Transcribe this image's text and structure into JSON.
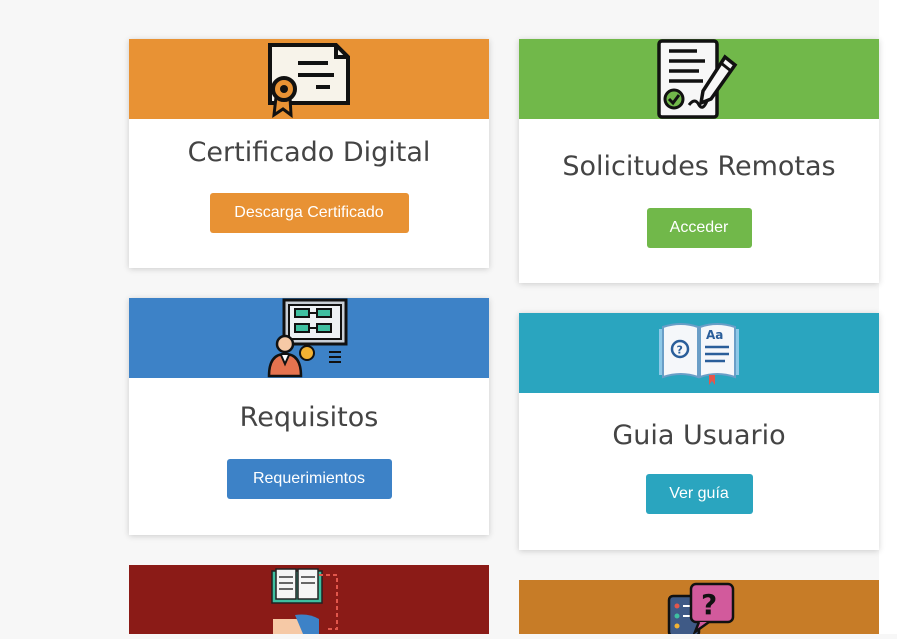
{
  "cards": [
    {
      "title": "Certificado Digital",
      "button": "Descarga Certificado",
      "color": "#e89234",
      "icon": "certificate-icon"
    },
    {
      "title": "Solicitudes Remotas",
      "button": "Acceder",
      "color": "#71b84a",
      "icon": "signed-document-icon"
    },
    {
      "title": "Requisitos",
      "button": "Requerimientos",
      "color": "#3d82c7",
      "icon": "presentation-icon"
    },
    {
      "title": "Guia Usuario",
      "button": "Ver guía",
      "color": "#2aa5bf",
      "icon": "open-book-icon"
    },
    {
      "title": "",
      "button": "",
      "color": "#8b1b17",
      "icon": "book-handshake-icon"
    },
    {
      "title": "",
      "button": "",
      "color": "#c77c27",
      "icon": "faq-chat-icon"
    }
  ]
}
